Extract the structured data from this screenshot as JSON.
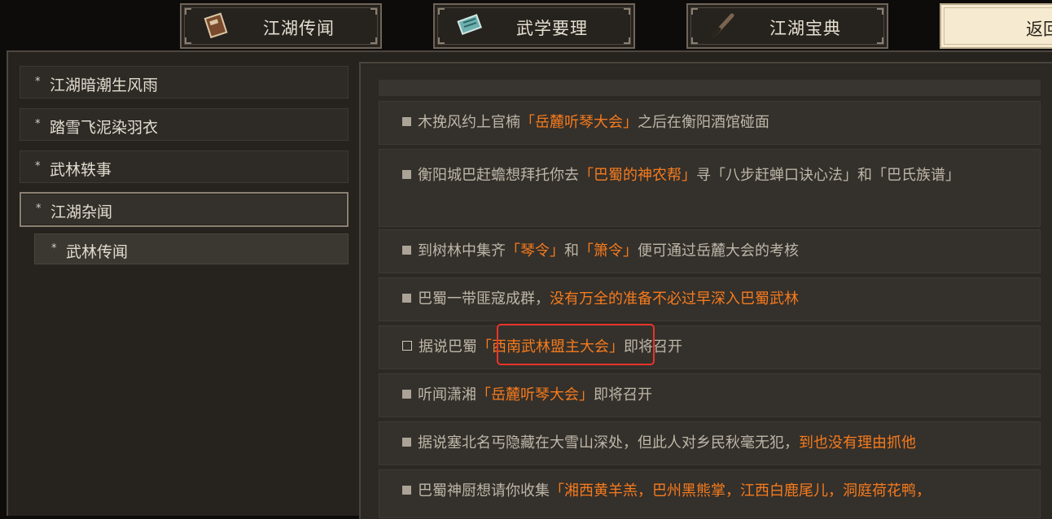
{
  "tabs": [
    {
      "label": "江湖传闻",
      "icon": "book-icon"
    },
    {
      "label": "武学要理",
      "icon": "scroll-icon"
    },
    {
      "label": "江湖宝典",
      "icon": "brush-icon"
    }
  ],
  "back_button": {
    "label": "返回"
  },
  "categories": [
    {
      "star": "*",
      "label": "江湖暗潮生风雨"
    },
    {
      "star": "*",
      "label": "踏雪飞泥染羽衣"
    },
    {
      "star": "*",
      "label": "武林轶事"
    },
    {
      "star": "*",
      "label": "江湖杂闻"
    }
  ],
  "subcategory": {
    "star": "*",
    "label": "武林传闻"
  },
  "entries": [
    {
      "parts": [
        "木挽风约上官楠",
        "「岳麓听琴大会」",
        "之后在衡阳酒馆碰面"
      ]
    },
    {
      "parts": [
        "衡阳城巴赶蟾想拜托你去",
        "「巴蜀的神农帮」",
        "寻「八步赶蝉口诀心法」和「巴氏族谱」"
      ]
    },
    {
      "parts": [
        "到树林中集齐",
        "「琴令」",
        "和",
        "「箫令」",
        "便可通过岳麓大会的考核"
      ]
    },
    {
      "parts": [
        "巴蜀一带匪寇成群，",
        "没有万全的准备不必过早深入巴蜀武林"
      ]
    },
    {
      "parts": [
        "据说巴蜀",
        "「西南武林盟主大会」",
        "即将召开"
      ]
    },
    {
      "parts": [
        "听闻潇湘",
        "「岳麓听琴大会」",
        "即将召开"
      ]
    },
    {
      "parts": [
        "据说塞北名丐隐藏在大雪山深处，但此人对乡民秋毫无犯，",
        "到也没有理由抓他"
      ]
    },
    {
      "parts": [
        "巴蜀神厨想请你收集",
        "「湘西黄羊羔，巴州黑熊掌，江西白鹿尾儿，洞庭荷花鸭，"
      ]
    }
  ],
  "colors": {
    "highlight": "#f57b1e",
    "annotation": "#e8342a"
  }
}
